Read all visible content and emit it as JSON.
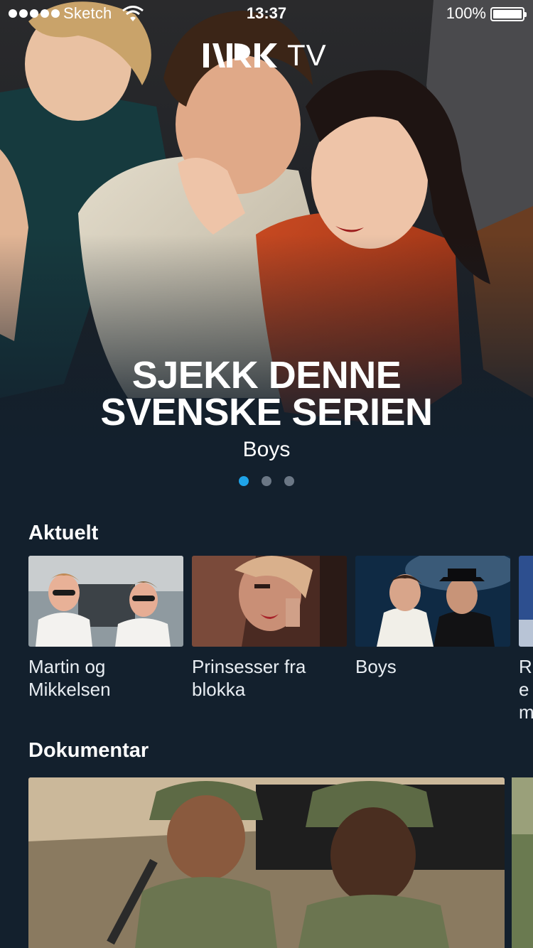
{
  "status_bar": {
    "carrier": "Sketch",
    "time": "13:37",
    "battery": "100%",
    "icons": [
      "signal-dots-icon",
      "wifi-icon",
      "battery-icon"
    ]
  },
  "header": {
    "logo_text": "NRK",
    "logo_suffix": "TV"
  },
  "hero": {
    "title_line1": "SJEKK DENNE",
    "title_line2": "SVENSKE SERIEN",
    "subtitle": "Boys",
    "pager": {
      "count": 3,
      "active": 0
    }
  },
  "sections": {
    "aktuelt": {
      "title": "Aktuelt",
      "items": [
        {
          "title": "Martin og Mikkelsen"
        },
        {
          "title": "Prinsesser fra blokka"
        },
        {
          "title": "Boys"
        },
        {
          "title": "Re m"
        }
      ]
    },
    "dokumentar": {
      "title": "Dokumentar"
    }
  },
  "colors": {
    "background": "#13202d",
    "accent": "#1fa3e8",
    "dot_inactive": "#6b7785"
  }
}
